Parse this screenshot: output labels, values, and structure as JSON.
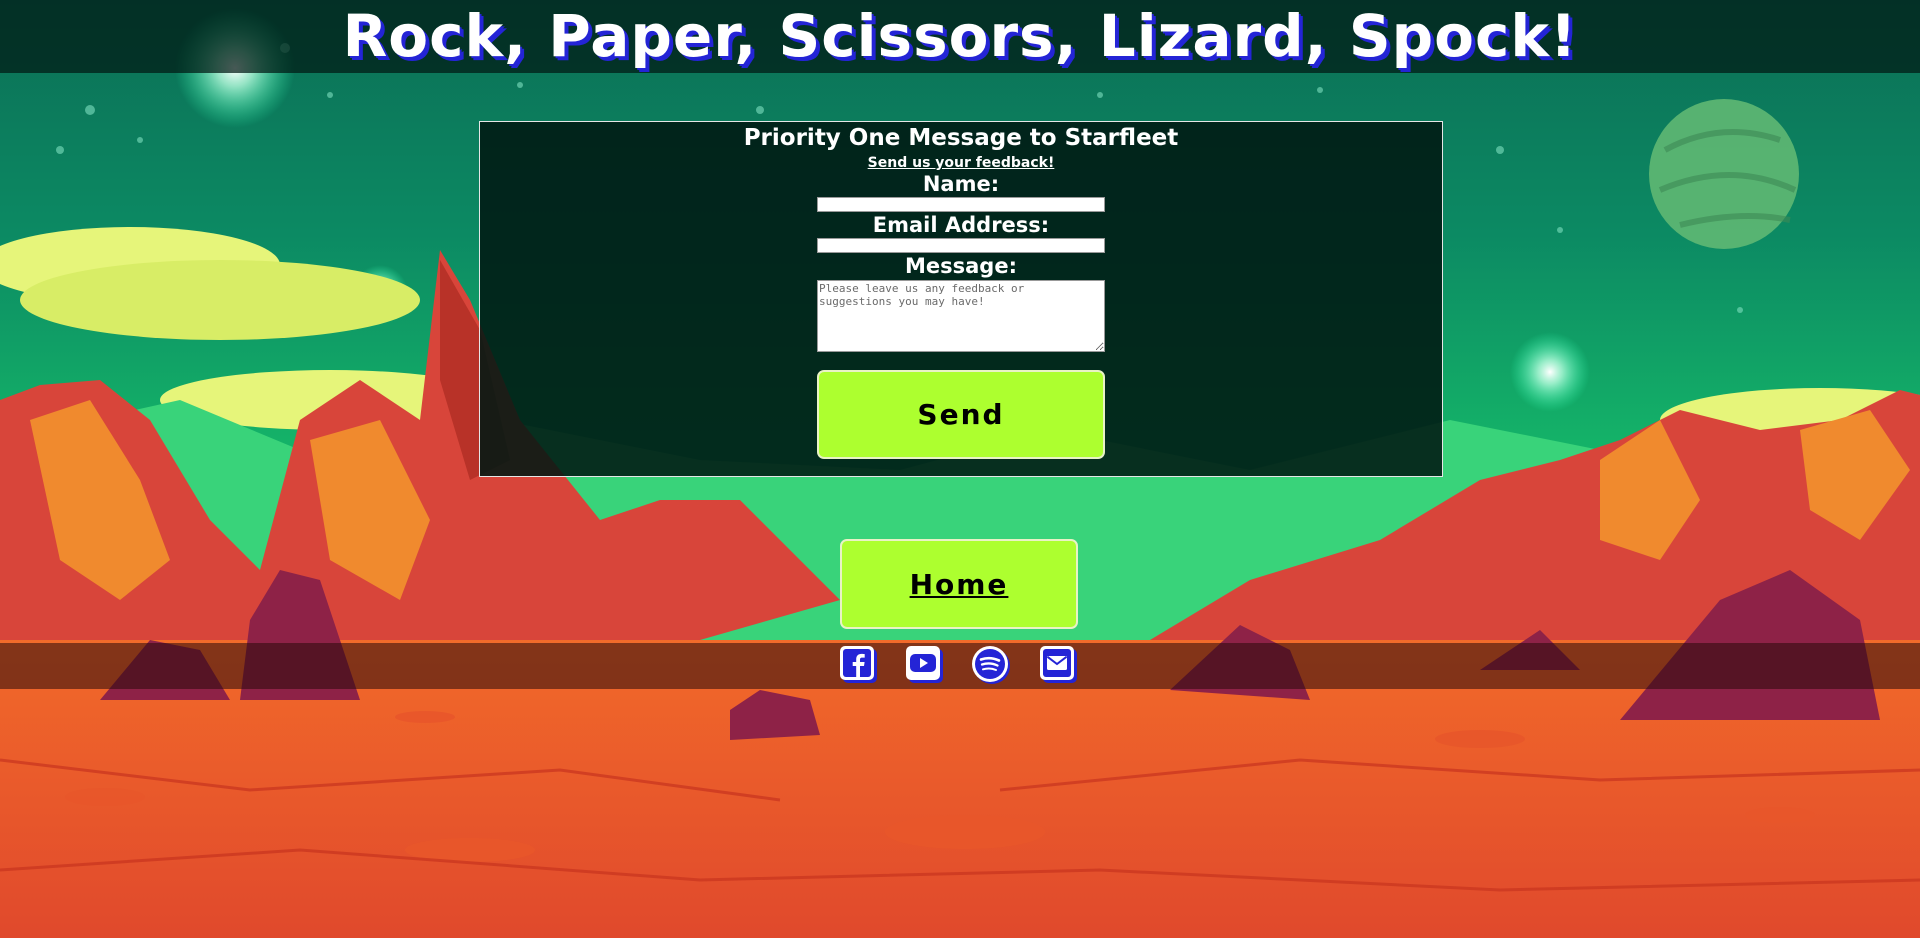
{
  "header": {
    "title": "Rock, Paper, Scissors, Lizard, Spock!"
  },
  "form": {
    "heading": "Priority One Message to Starfleet",
    "feedback_link": "Send us your feedback!",
    "name_label": "Name:",
    "name_value": "",
    "email_label": "Email Address:",
    "email_value": "",
    "message_label": "Message:",
    "message_placeholder": "Please leave us any feedback or suggestions you may have!",
    "send_label": "Send"
  },
  "nav": {
    "home_label": "Home"
  },
  "social": {
    "links": [
      {
        "icon": "facebook-icon"
      },
      {
        "icon": "youtube-icon"
      },
      {
        "icon": "spotify-icon"
      },
      {
        "icon": "email-icon"
      }
    ]
  },
  "theme": {
    "button_color": "#adff2f",
    "title_shadow_color": "#2424d6",
    "icon_color": "#2424d6"
  }
}
